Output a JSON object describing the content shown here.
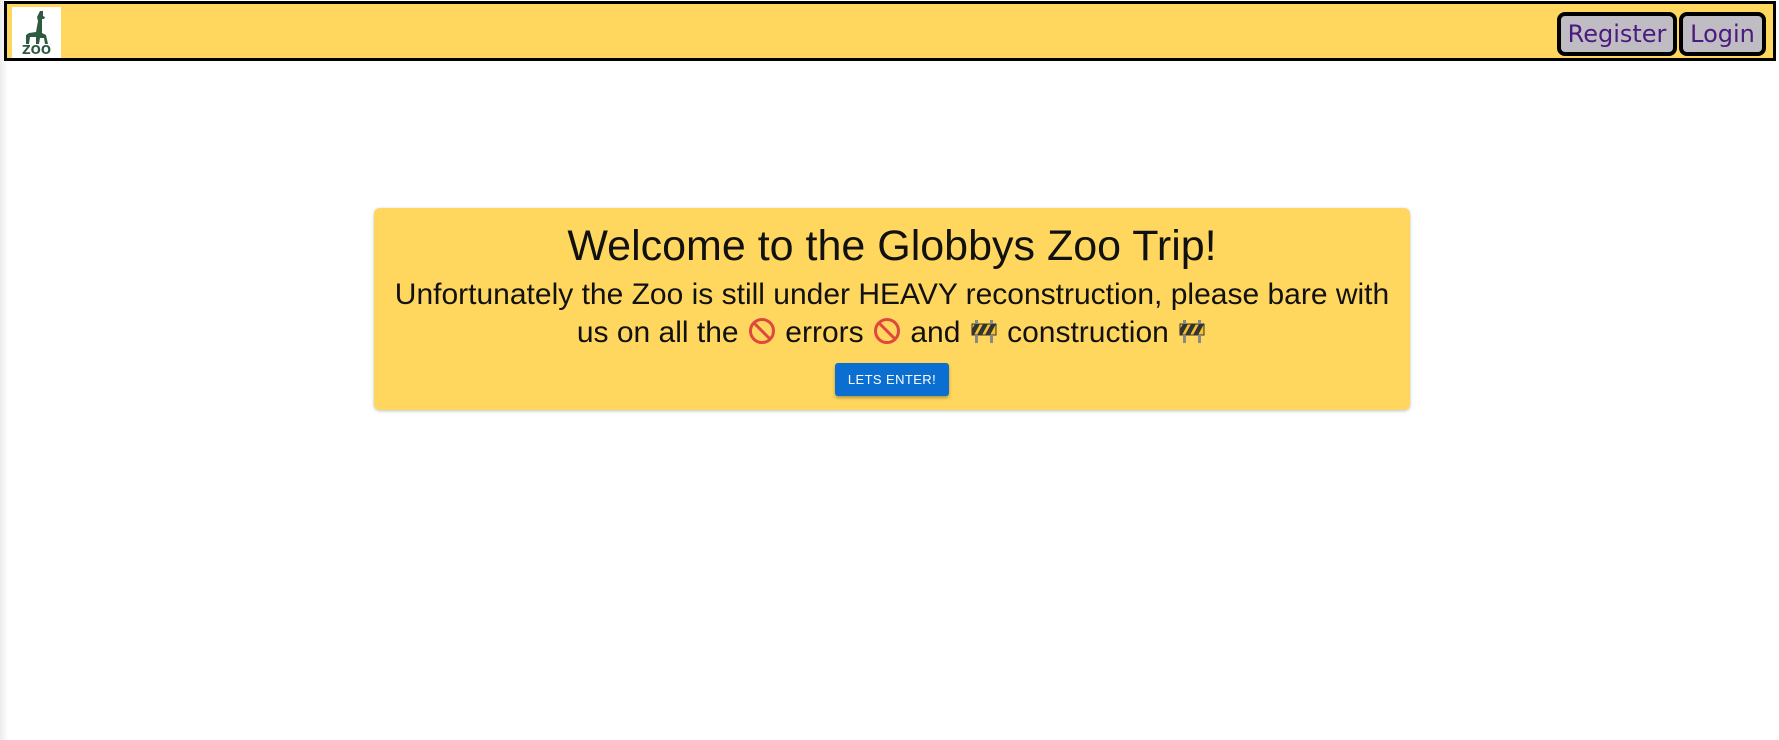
{
  "navbar": {
    "logo_text": "ZOO",
    "register_label": "Register",
    "login_label": "Login"
  },
  "welcome": {
    "title": "Welcome to the Globbys Zoo Trip!",
    "message_part1": "Unfortunately the Zoo is still under HEAVY reconstruction, please bare with us on all the",
    "message_part2": "errors",
    "message_part3": "and",
    "message_part4": "construction",
    "enter_label": "LETS ENTER!"
  },
  "icons": {
    "logo": "giraffe-zoo-logo-icon",
    "error": "prohibited-icon",
    "construction": "construction-barrier-icon"
  },
  "colors": {
    "navbar_bg": "#ffd75e",
    "nav_button_bg": "#bfbcc4",
    "nav_button_text": "#4b1b7d",
    "card_bg": "#ffd75e",
    "enter_button_bg": "#0b6fd1"
  }
}
